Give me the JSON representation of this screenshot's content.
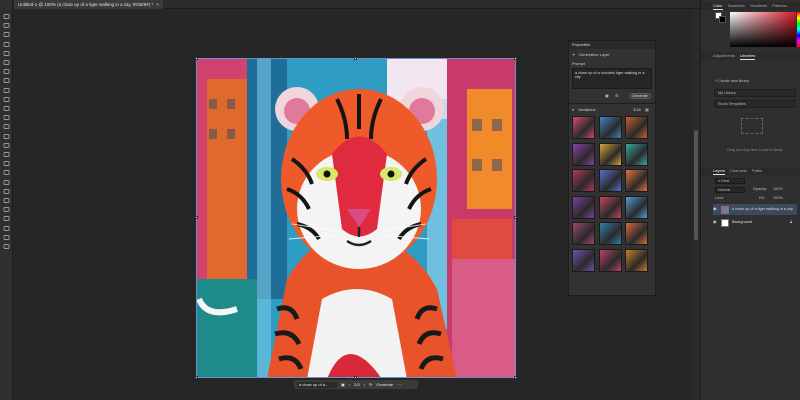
{
  "document": {
    "tab_title": "Untitled-1 @ 100% (a close up of a tiger walking in a city, RGB/8#) *",
    "close_glyph": "×"
  },
  "toolbar": {
    "tools": [
      "move",
      "artboard",
      "marquee",
      "lasso",
      "object-select",
      "crop",
      "frame",
      "eyedropper",
      "healing",
      "brush",
      "clone",
      "history-brush",
      "eraser",
      "gradient",
      "blur",
      "dodge",
      "pen",
      "type",
      "path-select",
      "rectangle",
      "hand",
      "zoom",
      "more",
      "fg-bg-colors",
      "quick-mask",
      "screen-mode"
    ]
  },
  "taskbar": {
    "prompt_value": "a close up of a...",
    "page": "2/3",
    "generate_label": "Generate",
    "more_label": "···"
  },
  "properties": {
    "title": "Properties",
    "layer_type": "Generative Layer",
    "prompt_label": "Prompt",
    "prompt_value": "a close up of a colourful tiger walking in a city",
    "generate_label": "Generate",
    "variations_label": "Variations",
    "variations_count": "3/18",
    "variation_palette": [
      "#d34a6a",
      "#3b86c7",
      "#c9602e",
      "#8f3fa8",
      "#d8a23a",
      "#3aa6a0",
      "#b5385a",
      "#5a6fd1",
      "#e0743b",
      "#7b3e9b",
      "#c9445b",
      "#4e9fd0",
      "#a2476f",
      "#2f7fa8",
      "#d46a3b",
      "#6d52b0",
      "#bd3f68",
      "#c97d2e"
    ]
  },
  "right_panel": {
    "color_tabs": [
      "Color",
      "Swatches",
      "Gradients",
      "Patterns"
    ],
    "library_tabs": [
      "Adjustments",
      "Libraries"
    ],
    "create_library": "+ Create new library",
    "my_library": "My Library",
    "stock_templates": "Stock Templates",
    "drag_hint": "Drag and drop here to add to library",
    "layer_tabs": [
      "Layers",
      "Channels",
      "Paths"
    ],
    "filter_kind": "Kind",
    "blend_mode": "Normal",
    "opacity_label": "Opacity:",
    "opacity_value": "100%",
    "lock_label": "Lock:",
    "fill_label": "Fill:",
    "fill_value": "100%",
    "layers": [
      {
        "name": "a close up of a tiger walking in a city"
      },
      {
        "name": "Background"
      }
    ]
  }
}
